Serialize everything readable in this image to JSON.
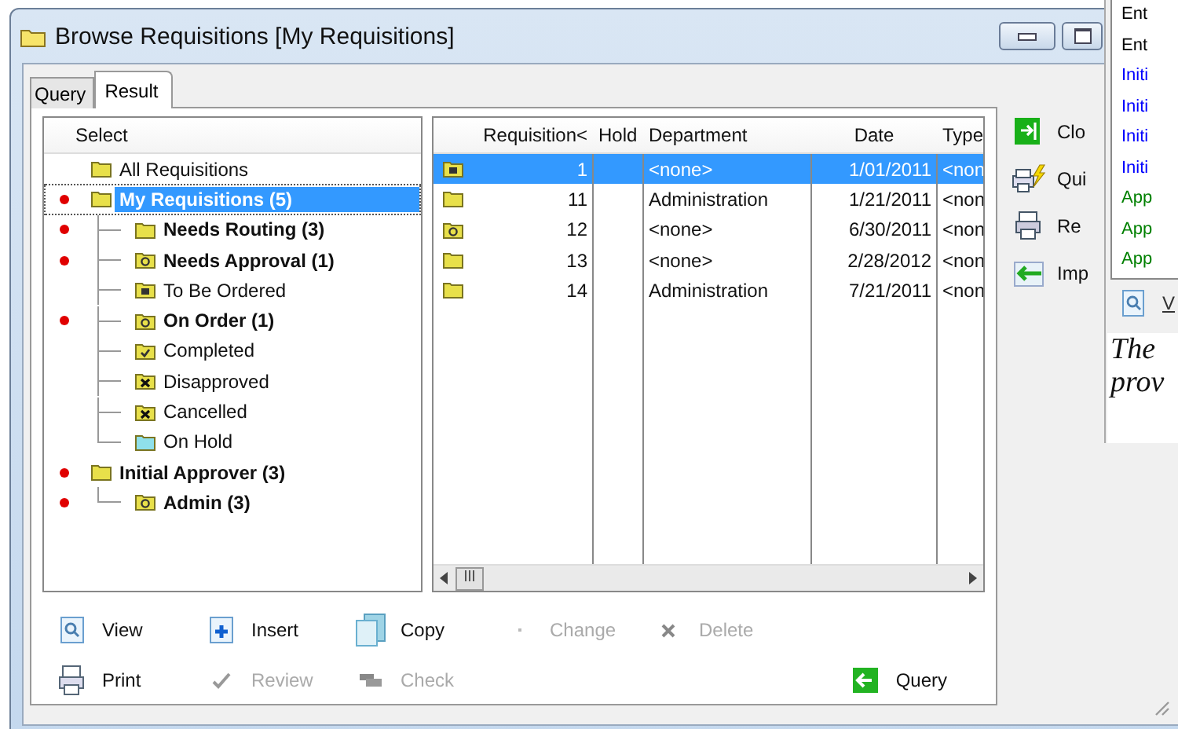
{
  "window": {
    "title": "Browse Requisitions [My Requisitions]"
  },
  "tabs": [
    {
      "label": "Query",
      "selected": false
    },
    {
      "label": "Result",
      "selected": true
    }
  ],
  "tree": {
    "header": "Select",
    "items": [
      {
        "label": "All Requisitions",
        "kind": "folder",
        "bold": false,
        "flagged": false,
        "selected": false
      },
      {
        "label": "My Requisitions (5)",
        "kind": "folder",
        "bold": true,
        "flagged": true,
        "selected": true,
        "children": [
          {
            "label": "Needs Routing (3)",
            "kind": "folder",
            "bold": true,
            "flagged": true,
            "selected": false
          },
          {
            "label": "Needs Approval (1)",
            "kind": "question",
            "bold": true,
            "flagged": true,
            "selected": false
          },
          {
            "label": "To Be Ordered",
            "kind": "box",
            "bold": false,
            "flagged": false,
            "selected": false
          },
          {
            "label": "On Order (1)",
            "kind": "question",
            "bold": true,
            "flagged": true,
            "selected": false
          },
          {
            "label": "Completed",
            "kind": "check",
            "bold": false,
            "flagged": false,
            "selected": false
          },
          {
            "label": "Disapproved",
            "kind": "cross",
            "bold": false,
            "flagged": false,
            "selected": false
          },
          {
            "label": "Cancelled",
            "kind": "cross",
            "bold": false,
            "flagged": false,
            "selected": false
          },
          {
            "label": "On Hold",
            "kind": "hold",
            "bold": false,
            "flagged": false,
            "selected": false
          }
        ]
      },
      {
        "label": "Initial Approver (3)",
        "kind": "folder",
        "bold": true,
        "flagged": true,
        "selected": false,
        "children": [
          {
            "label": "Admin (3)",
            "kind": "question",
            "bold": true,
            "flagged": true,
            "selected": false
          }
        ]
      }
    ]
  },
  "table": {
    "columns": [
      "Requisition<",
      "Hold",
      "Department",
      "Date",
      "Type"
    ],
    "rows": [
      {
        "kind": "box",
        "requisition": "1",
        "department": "<none>",
        "date": "1/01/2011",
        "type": "<non",
        "selected": true
      },
      {
        "kind": "folder",
        "requisition": "11",
        "department": "Administration",
        "date": "1/21/2011",
        "type": "<non",
        "selected": false
      },
      {
        "kind": "question",
        "requisition": "12",
        "department": "<none>",
        "date": "6/30/2011",
        "type": "<non",
        "selected": false
      },
      {
        "kind": "folder",
        "requisition": "13",
        "department": "<none>",
        "date": "2/28/2012",
        "type": "<non",
        "selected": false
      },
      {
        "kind": "folder",
        "requisition": "14",
        "department": "Administration",
        "date": "7/21/2011",
        "type": "<non",
        "selected": false
      }
    ]
  },
  "buttons": [
    [
      {
        "label": "View",
        "kind": "view",
        "disabled": false
      },
      {
        "label": "Insert",
        "kind": "insert",
        "disabled": false
      },
      {
        "label": "Copy",
        "kind": "copy",
        "disabled": false
      },
      {
        "label": "Change",
        "kind": "change",
        "disabled": true
      },
      {
        "label": "Delete",
        "kind": "delete",
        "disabled": true
      }
    ],
    [
      {
        "label": "Print",
        "kind": "print",
        "disabled": false
      },
      {
        "label": "Review",
        "kind": "review",
        "disabled": true
      },
      {
        "label": "Check",
        "kind": "check",
        "disabled": true
      }
    ]
  ],
  "query_button": {
    "label": "Query"
  },
  "side_actions": [
    {
      "label": "Clo",
      "kind": "close"
    },
    {
      "label": "Qui",
      "kind": "quick"
    },
    {
      "label": "Re",
      "kind": "print"
    },
    {
      "label": "Imp",
      "kind": "import"
    }
  ],
  "back_window": {
    "list": [
      {
        "text": "Ent",
        "color": "#000000"
      },
      {
        "text": "Ent",
        "color": "#000000"
      },
      {
        "text": "Initi",
        "color": "#0000ff"
      },
      {
        "text": "Initi",
        "color": "#0000ff"
      },
      {
        "text": "Initi",
        "color": "#0000ff"
      },
      {
        "text": "Initi",
        "color": "#0000ff"
      },
      {
        "text": "App",
        "color": "#008000"
      },
      {
        "text": "App",
        "color": "#008000"
      },
      {
        "text": "App",
        "color": "#008000"
      }
    ],
    "link": "V",
    "text_lines": [
      "The",
      "prov"
    ]
  }
}
